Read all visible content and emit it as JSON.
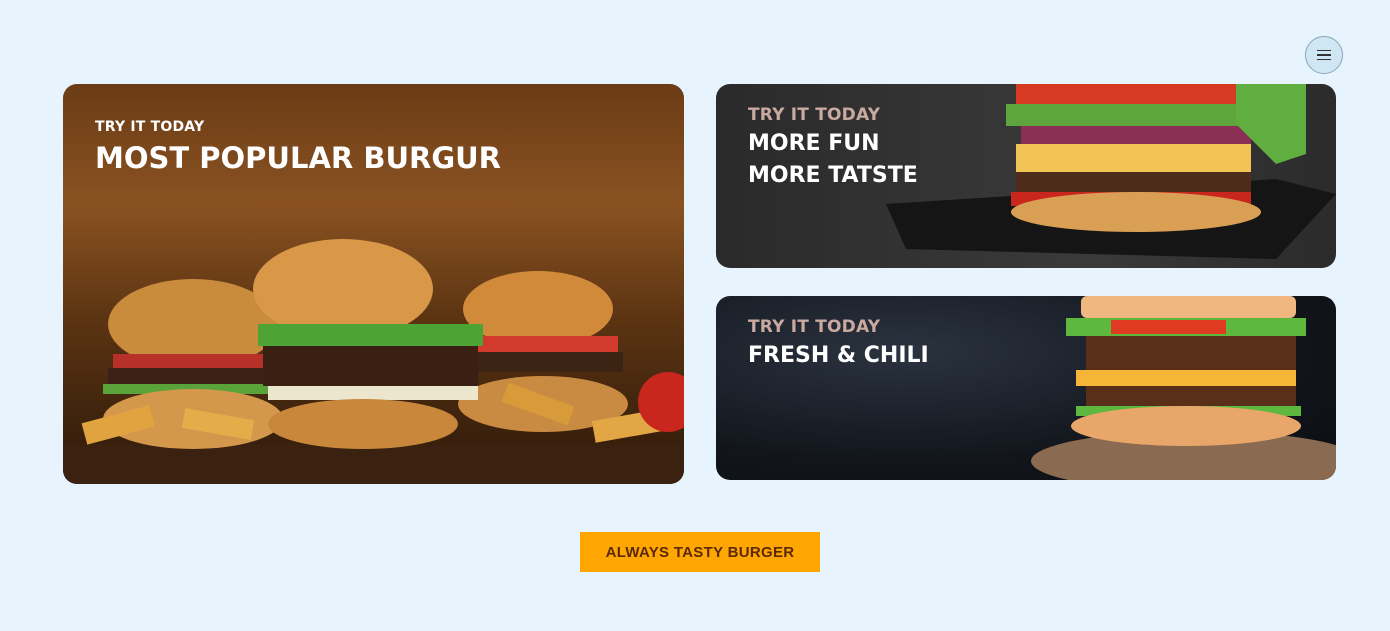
{
  "menu": {
    "icon": "hamburger-menu-icon"
  },
  "cards": [
    {
      "kicker": "TRY IT TODAY",
      "title": "MOST POPULAR BURGUR"
    },
    {
      "kicker": "TRY IT TODAY",
      "title_line1": "MORE FUN",
      "title_line2": "MORE TATSTE"
    },
    {
      "kicker": "TRY IT TODAY",
      "title": "FRESH & CHILI"
    }
  ],
  "cta": {
    "label": "ALWAYS TASTY BURGER"
  },
  "colors": {
    "background": "#e8f4fd",
    "cta": "#ffa600",
    "cta_text": "#5a2a0a"
  }
}
